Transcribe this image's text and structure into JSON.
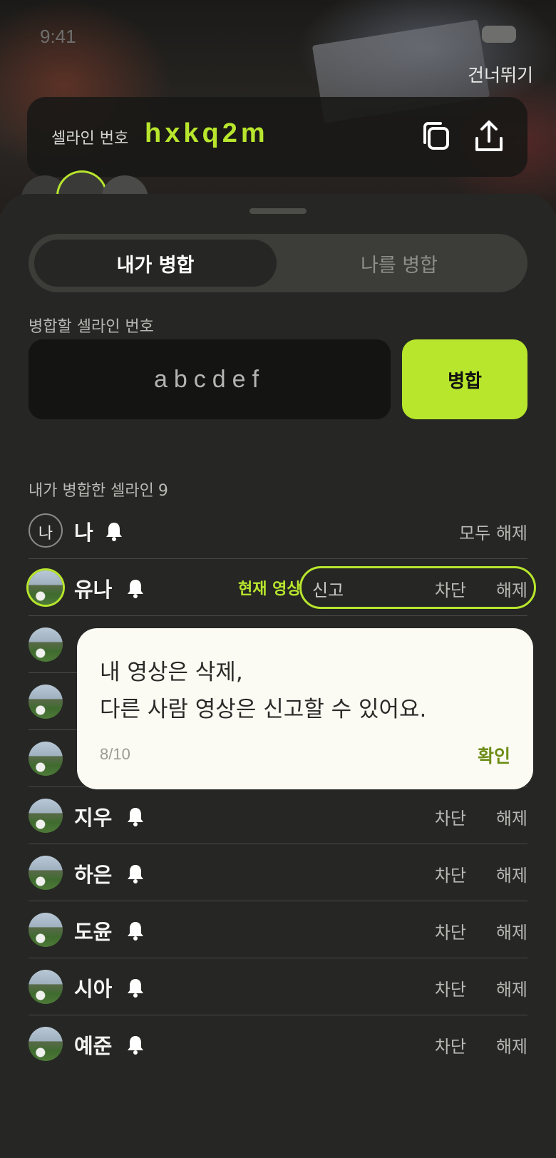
{
  "status_bar": {
    "time": "9:41"
  },
  "header": {
    "skip_label": "건너뛰기"
  },
  "code_card": {
    "label": "셀라인 번호",
    "code": "hxkq2m",
    "copy_icon": "copy-icon",
    "share_icon": "share-icon"
  },
  "tabs": [
    {
      "label": "내가 병합",
      "active": true
    },
    {
      "label": "나를 병합",
      "active": false
    }
  ],
  "merge_form": {
    "field_label": "병합할 셀라인 번호",
    "input_value": "abcdef",
    "button_label": "병합"
  },
  "list": {
    "title": "내가 병합한 셀라인",
    "count": "9",
    "me": {
      "name": "나",
      "avatar_text": "나",
      "action": "모두 해제"
    },
    "current": {
      "name": "유나",
      "current_video_label": "현재 영상",
      "report_label": "신고",
      "block_label": "차단",
      "unblock_label": "해제"
    },
    "members": [
      {
        "name": "지우",
        "block": "차단",
        "unblock": "해제"
      },
      {
        "name": "하은",
        "block": "차단",
        "unblock": "해제"
      },
      {
        "name": "도윤",
        "block": "차단",
        "unblock": "해제"
      },
      {
        "name": "시아",
        "block": "차단",
        "unblock": "해제"
      },
      {
        "name": "예준",
        "block": "차단",
        "unblock": "해제"
      }
    ]
  },
  "tooltip": {
    "line1": "내 영상은 삭제,",
    "line2": "다른 사람 영상은 신고할 수 있어요.",
    "step": "8/10",
    "confirm": "확인"
  },
  "colors": {
    "accent": "#b8e62d",
    "sheet": "#262724",
    "tooltip_bg": "#fbfbf3"
  }
}
